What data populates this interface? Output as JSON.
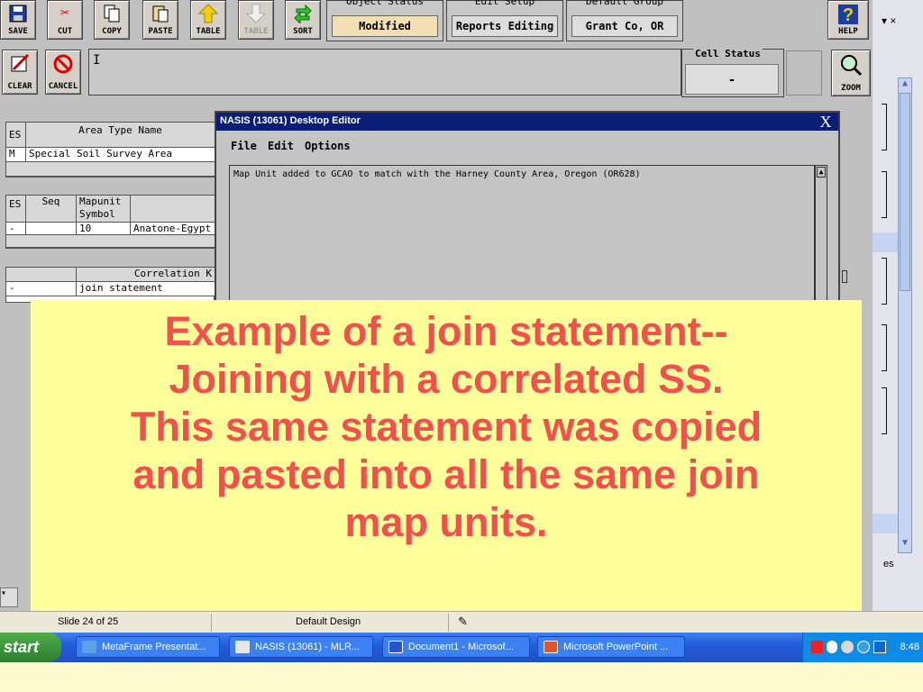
{
  "toolbar": {
    "save": "SAVE",
    "cut": "CUT",
    "copy": "COPY",
    "paste": "PASTE",
    "table": "TABLE",
    "table_disabled": "TABLE",
    "sort": "SORT",
    "help": "HELP",
    "clear": "CLEAR",
    "cancel": "CANCEL",
    "zoom": "ZOOM"
  },
  "groups": {
    "object_status_header": "Object Status",
    "object_status": "Modified",
    "edit_setup_header": "Edit Setup",
    "edit_setup": "Reports Editing",
    "default_group_header": "Default Group",
    "default_group": "Grant Co, OR",
    "cell_status_label": "Cell Status",
    "cell_status_value": "-"
  },
  "edit_line": {
    "value": "I"
  },
  "grid_area": {
    "es": "ES",
    "col_header": "Area Type Name",
    "row_flag": "M",
    "row_value": "Special Soil Survey Area"
  },
  "grid_mapunit": {
    "es": "ES",
    "seq": "Seq",
    "symbol_header": "Mapunit Symbol",
    "row_flag": "-",
    "symbol": "10",
    "name": "Anatone-Egypt"
  },
  "grid_correlation": {
    "header": "Correlation K",
    "row_flag": "-",
    "value": "join statement"
  },
  "editor": {
    "title": "NASIS (13061) Desktop Editor",
    "close": "X",
    "menu": [
      "File",
      "Edit",
      "Options"
    ],
    "text": "Map Unit added to GCAO to match with the Harney County Area, Oregon (OR628)"
  },
  "right_panel": {
    "es_text": "es",
    "close_text": "▾ ×"
  },
  "callout": {
    "lines": [
      "Example of a join statement--",
      "Joining with a correlated SS.",
      "This same statement was copied",
      "and pasted into all the same join",
      "map units."
    ]
  },
  "status_bar": {
    "slide": "Slide 24 of 25",
    "design": "Default Design"
  },
  "taskbar": {
    "start": "start",
    "tasks": [
      "MetaFrame Presentat...",
      "NASIS (13061) - MLR...",
      "Document1 - Microsof...",
      "Microsoft PowerPoint ..."
    ],
    "clock": "8:48"
  }
}
